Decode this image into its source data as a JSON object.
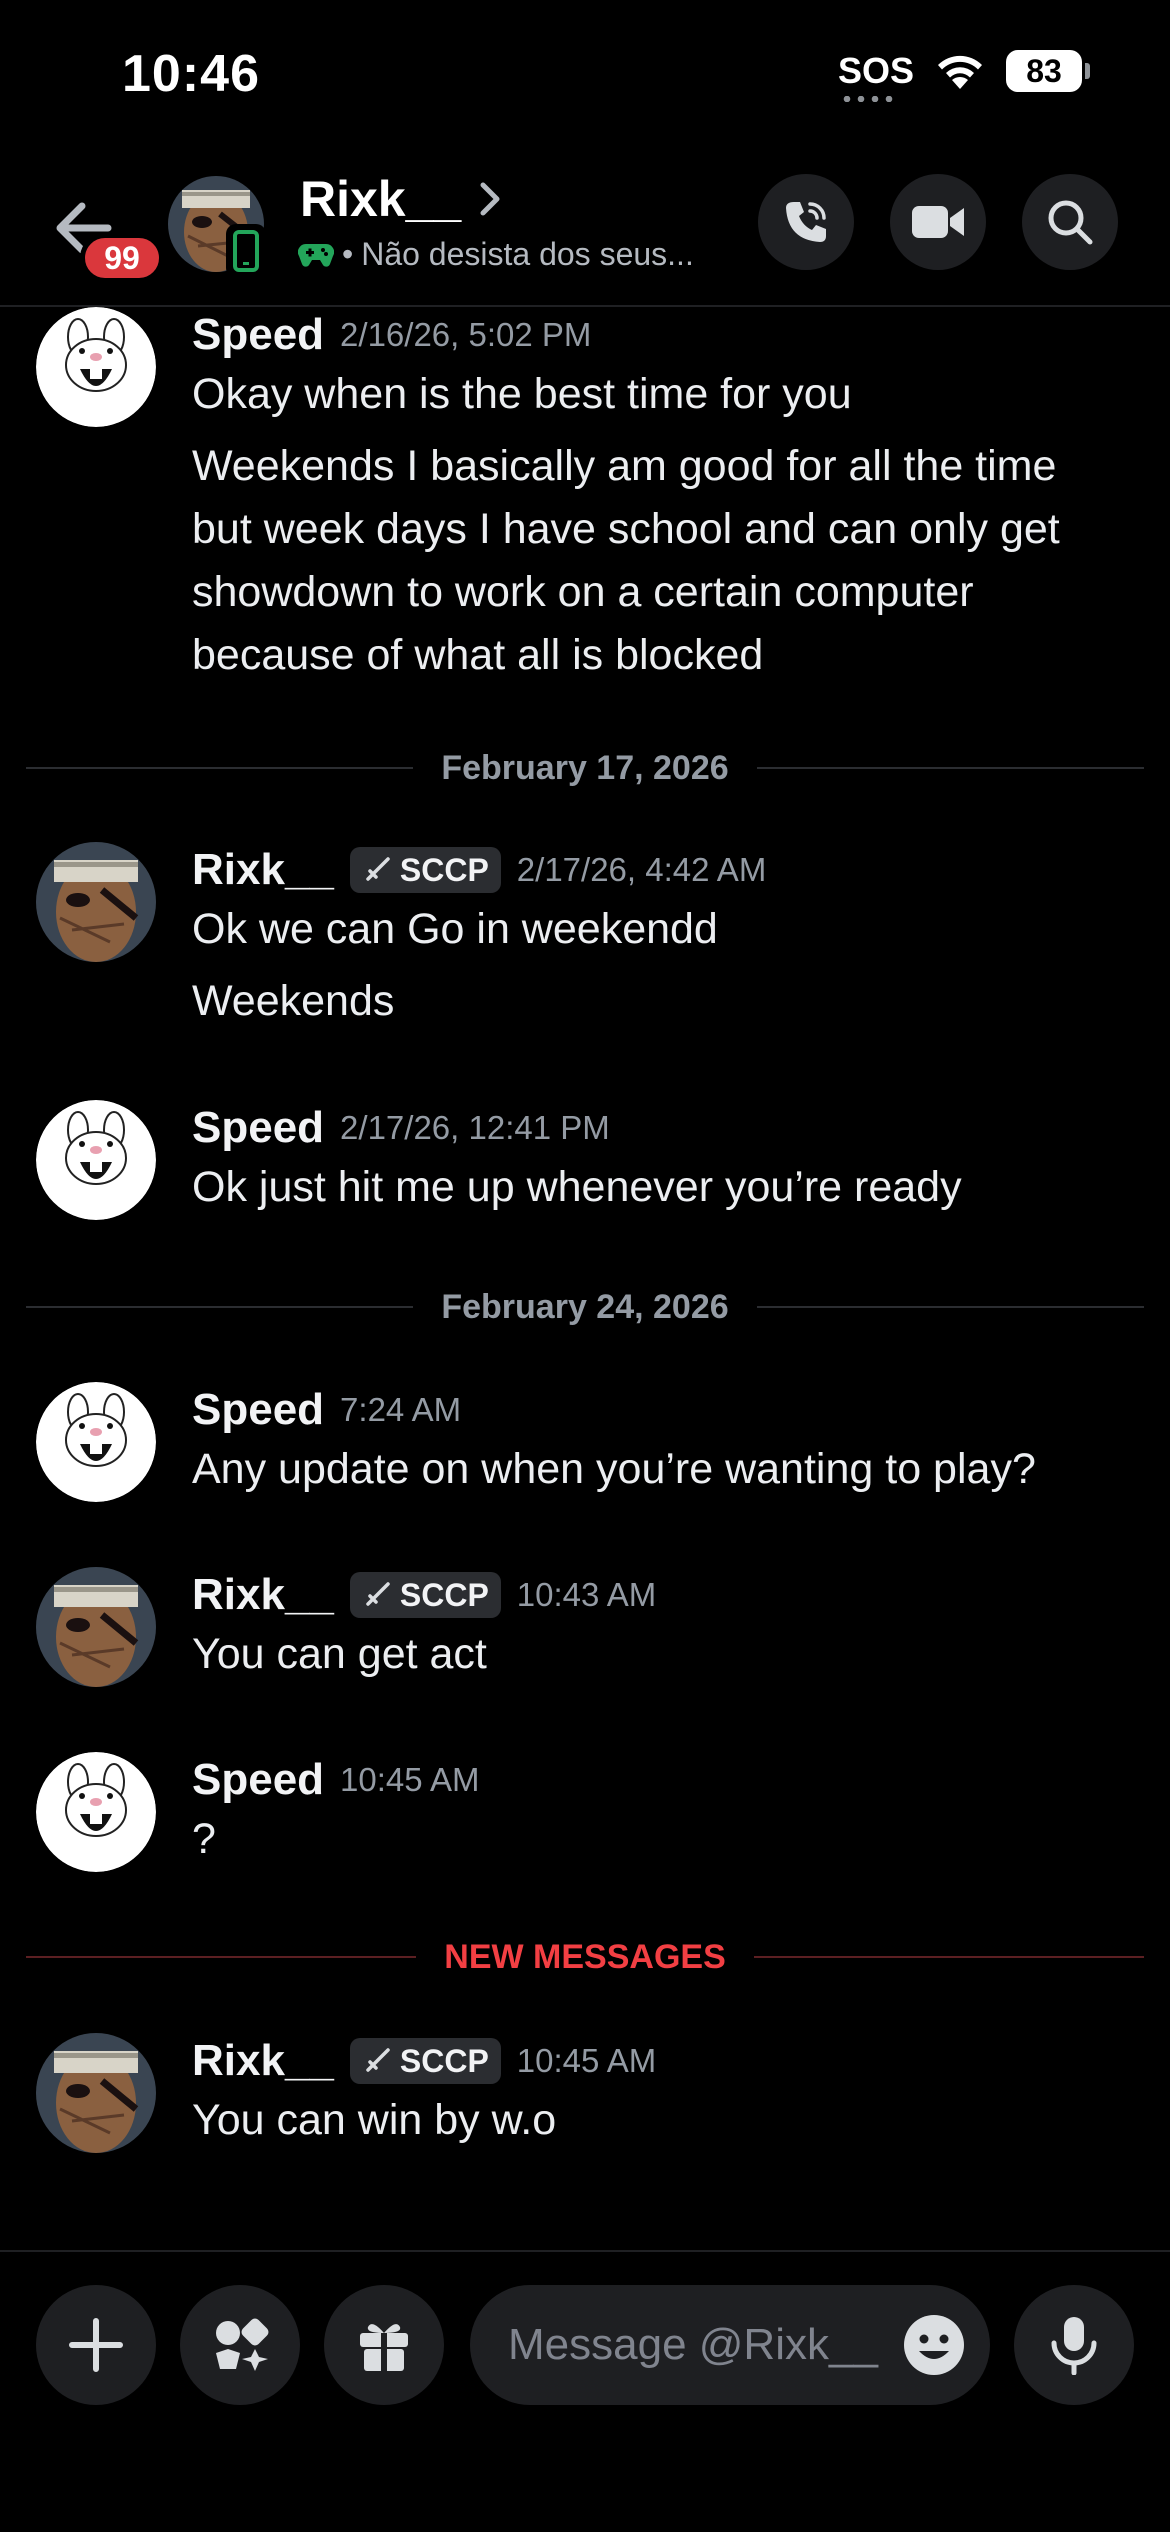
{
  "status_bar": {
    "time": "10:46",
    "sos": "SOS",
    "battery": "83"
  },
  "header": {
    "unread_count": "99",
    "name": "Rixk__",
    "status_text": "Não desista dos seus...",
    "status_sep": "•"
  },
  "messages": [
    {
      "author": "Speed",
      "time": "2/16/26, 5:02 PM",
      "lines": [
        "Okay when is the best time for you",
        "Weekends I basically am good for all the time",
        "but week days I have school and can only get",
        "showdown to work on a certain computer",
        "because of what all is blocked"
      ]
    },
    {
      "divider": "February 17, 2026"
    },
    {
      "author": "Rixk__",
      "tag": "SCCP",
      "time": "2/17/26, 4:42 AM",
      "lines": [
        "Ok we can Go in weekendd",
        "Weekends"
      ]
    },
    {
      "author": "Speed",
      "time": "2/17/26, 12:41 PM",
      "lines": [
        "Ok just hit me up whenever you’re ready"
      ]
    },
    {
      "divider": "February 24, 2026"
    },
    {
      "author": "Speed",
      "time": "7:24 AM",
      "lines": [
        "Any update on when you’re wanting to play?"
      ]
    },
    {
      "author": "Rixk__",
      "tag": "SCCP",
      "time": "10:43 AM",
      "lines": [
        "You can get act"
      ]
    },
    {
      "author": "Speed",
      "time": "10:45 AM",
      "lines": [
        "?"
      ]
    },
    {
      "divider": "NEW MESSAGES"
    },
    {
      "author": "Rixk__",
      "tag": "SCCP",
      "time": "10:45 AM",
      "lines": [
        "You can win by w.o"
      ]
    }
  ],
  "composer": {
    "placeholder": "Message @Rixk__"
  },
  "colors": {
    "new_messages": "#f23f43",
    "badge": "#da373c",
    "presence_phone": "#23a55a",
    "game_icon": "#23a55a"
  }
}
